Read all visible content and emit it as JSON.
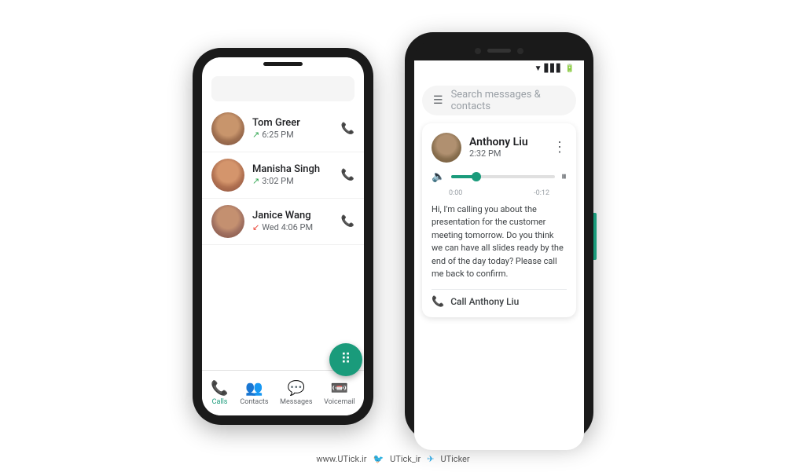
{
  "phone1": {
    "contacts": [
      {
        "name": "Tom Greer",
        "time": "6:25 PM",
        "call_type": "outgoing"
      },
      {
        "name": "Manisha Singh",
        "time": "3:02 PM",
        "call_type": "outgoing"
      },
      {
        "name": "Janice Wang",
        "time": "Wed 4:06 PM",
        "call_type": "missed"
      }
    ],
    "nav_items": [
      {
        "label": "Calls",
        "active": true
      },
      {
        "label": "Contacts",
        "active": false
      },
      {
        "label": "Messages",
        "active": false
      },
      {
        "label": "Voicemail",
        "active": false
      }
    ]
  },
  "phone2": {
    "search_placeholder": "Search messages & contacts",
    "voicemail": {
      "contact_name": "Anthony Liu",
      "time": "2:32 PM",
      "progress_current": "0:00",
      "progress_end": "-0:12",
      "transcript": "Hi, I'm calling you about the presentation for the customer meeting tomorrow. Do you think we can have all slides ready by the end of the day today? Please call me back to confirm.",
      "call_back_label": "Call Anthony Liu"
    }
  },
  "watermark": {
    "site": "www.UTick.ir",
    "twitter": "UTick_ir",
    "telegram": "UTicker"
  }
}
